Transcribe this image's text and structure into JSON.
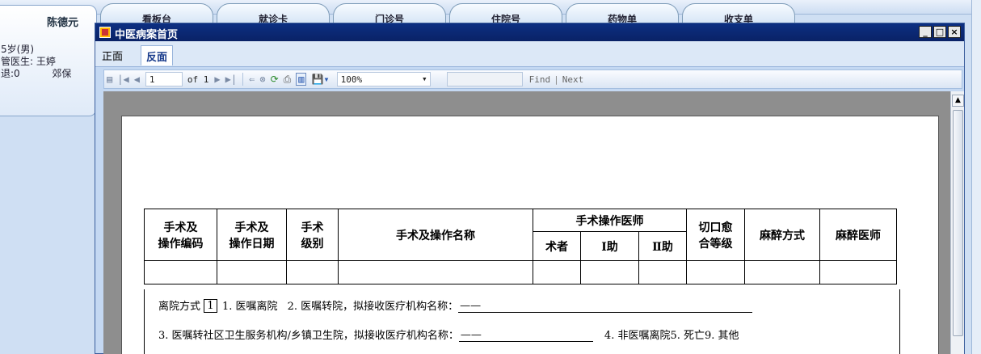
{
  "background": {
    "tabs": [
      "看板台",
      "就诊卡",
      "门诊号",
      "住院号",
      "药物单",
      "收支单"
    ],
    "patient": {
      "name": "陈德元",
      "line1": "5岁(男)",
      "line2": "管医生: 王婷",
      "line3": "退:0",
      "line3_right": "郊保"
    }
  },
  "window": {
    "title": "中医病案首页",
    "controls": [
      "_",
      "□",
      "×"
    ],
    "tabs": [
      "正面",
      "反面"
    ]
  },
  "toolbar": {
    "page_value": "1",
    "of_text": "of 1",
    "zoom_value": "100%",
    "find_label": "Find",
    "separator": "|",
    "next_label": "Next"
  },
  "report": {
    "headers": {
      "code": [
        "手术及",
        "操作编码"
      ],
      "date": [
        "手术及",
        "操作日期"
      ],
      "level": [
        "手术",
        "级别"
      ],
      "name": "手术及操作名称",
      "doctor_group": "手术操作医师",
      "surgeon": "术者",
      "assist1": "Ⅰ助",
      "assist2": "Ⅱ助",
      "incision": [
        "切口愈",
        "合等级"
      ],
      "anesthesia_method": "麻醉方式",
      "anesthesiologist": "麻醉医师"
    },
    "discharge": {
      "label": "离院方式",
      "value": "1",
      "opt1": "1. 医嘱离院",
      "opt2": "2. 医嘱转院，拟接收医疗机构名称：",
      "opt2_value": "——",
      "opt3": "3. 医嘱转社区卫生服务机构/乡镇卫生院，拟接收医疗机构名称：",
      "opt3_value": "——",
      "opt4": "4. 非医嘱离院5. 死亡9. 其他"
    }
  }
}
